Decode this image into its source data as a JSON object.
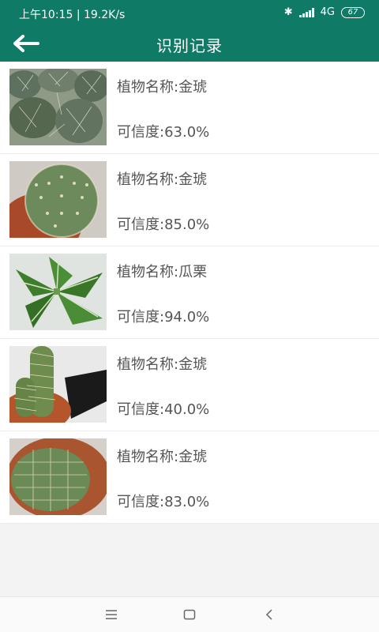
{
  "status_bar": {
    "time": "上午10:15",
    "speed": "19.2K/s",
    "network": "4G",
    "battery": "67"
  },
  "header": {
    "title": "识别记录"
  },
  "records": [
    {
      "name": "植物名称:金琥",
      "confidence": "可信度:63.0%",
      "image_icon": "cactus-cluster-photo"
    },
    {
      "name": "植物名称:金琥",
      "confidence": "可信度:85.0%",
      "image_icon": "potted-barrel-cactus-photo"
    },
    {
      "name": "植物名称:瓜栗",
      "confidence": "可信度:94.0%",
      "image_icon": "money-tree-leaves-photo"
    },
    {
      "name": "植物名称:金琥",
      "confidence": "可信度:40.0%",
      "image_icon": "columnar-cactus-photo"
    },
    {
      "name": "植物名称:金琥",
      "confidence": "可信度:83.0%",
      "image_icon": "potted-round-cactus-photo"
    }
  ],
  "colors": {
    "primary": "#0f7a66",
    "text": "#555555",
    "background": "#f3f3f3"
  },
  "nav_icons": [
    "menu-icon",
    "home-icon",
    "back-icon"
  ]
}
